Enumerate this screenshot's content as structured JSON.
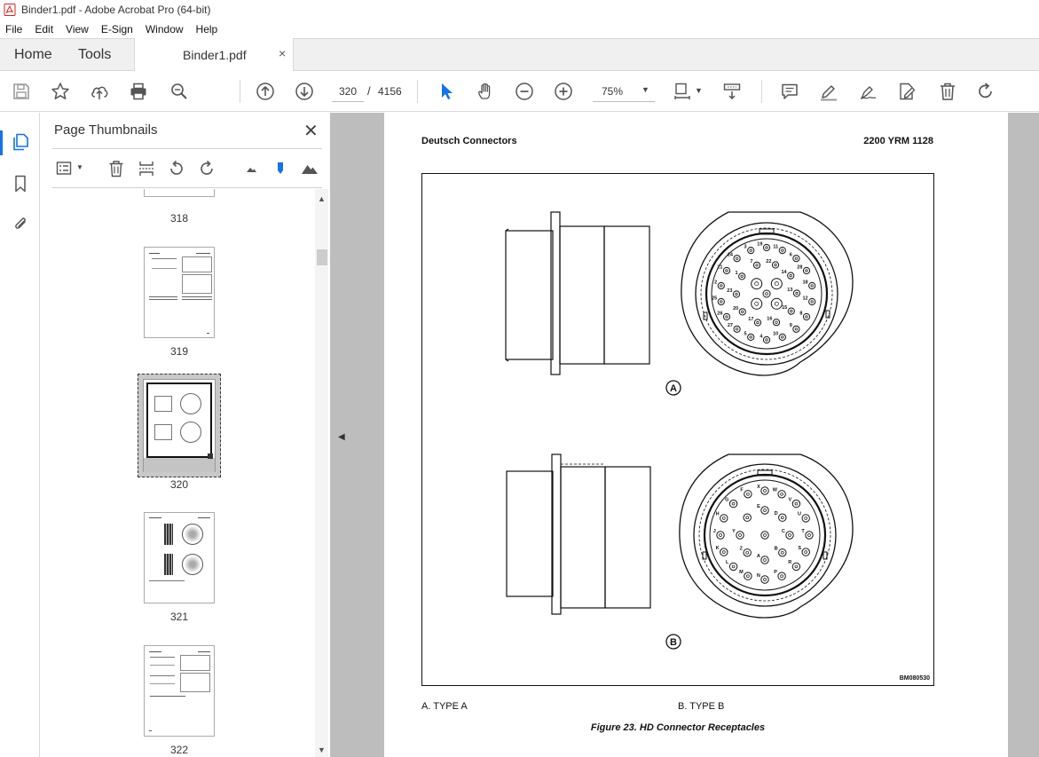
{
  "window": {
    "title": "Binder1.pdf - Adobe Acrobat Pro (64-bit)"
  },
  "menu": [
    "File",
    "Edit",
    "View",
    "E-Sign",
    "Window",
    "Help"
  ],
  "tabs": {
    "home": "Home",
    "tools": "Tools",
    "document": "Binder1.pdf",
    "close": "×"
  },
  "toolbar": {
    "current_page": "320",
    "page_separator": "/",
    "total_pages": "4156",
    "zoom": "75%"
  },
  "panel": {
    "title": "Page Thumbnails",
    "close": "✕",
    "thumbnails": [
      {
        "page": "318"
      },
      {
        "page": "319"
      },
      {
        "page": "320",
        "selected": true
      },
      {
        "page": "321"
      },
      {
        "page": "322"
      }
    ]
  },
  "document": {
    "header_left": "Deutsch Connectors",
    "header_right": "2200 YRM 1128",
    "figure_code": "BM080530",
    "label_a": "A",
    "label_b": "B",
    "caption_a": "A.   TYPE A",
    "caption_b": "B.   TYPE B",
    "figure_title": "Figure 23. HD Connector Receptacles",
    "pins_a": [
      "19",
      "11",
      "6",
      "28",
      "18",
      "12",
      "8",
      "9",
      "10",
      "4",
      "5",
      "27",
      "26",
      "25",
      "2",
      "21",
      "24",
      "3",
      "22",
      "14",
      "13",
      "15",
      "16",
      "17",
      "20",
      "23",
      "1",
      "7",
      "32",
      "31"
    ],
    "pins_b": [
      "X",
      "W",
      "V",
      "U",
      "T",
      "S",
      "R",
      "P",
      "N",
      "M",
      "L",
      "K",
      "J",
      "H",
      "G",
      "F",
      "E",
      "D",
      "C",
      "B",
      "A",
      "Z",
      "Y"
    ]
  },
  "colors": {
    "accent": "#1473e6",
    "doc_background": "#bdbdbd",
    "acrobat_red": "#d8231f"
  }
}
